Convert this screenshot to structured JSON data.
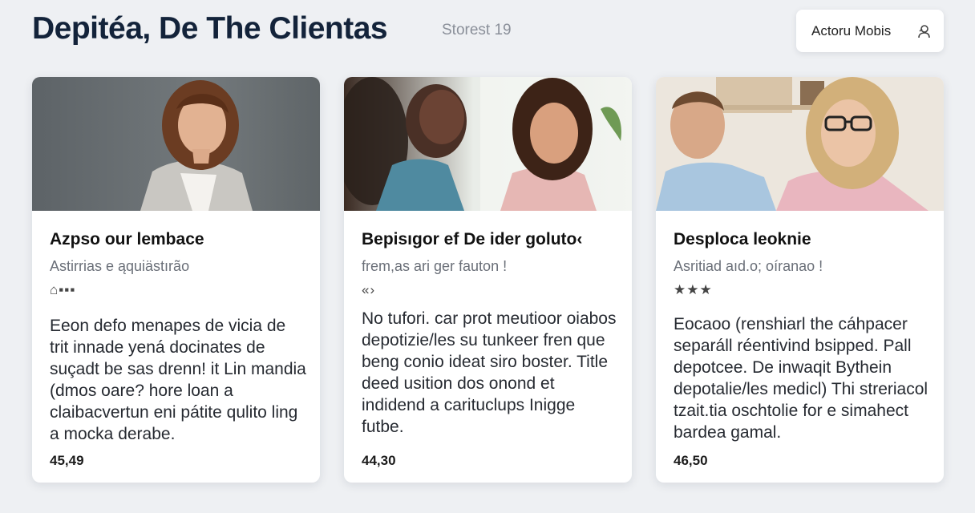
{
  "header": {
    "title": "Depitéa, De The Clientas",
    "subtitle": "Storest 19",
    "action_button": {
      "label": "Actoru Mobis",
      "icon": "user-icon"
    }
  },
  "cards": [
    {
      "title": "Azpso our lembace",
      "subtitle": "Astirrias e ąquiästırão",
      "rating": "⌂▪▪▪",
      "description": "Eeon defo menapes de vicia de trit innade yená docinates de suçadt be sas drenn! it Lin mandia (dmos oare? hore loan a claibacvertun eni pátite qulito ling a mocka derabe.",
      "price": "45,49",
      "photo_icon": "portrait-photo"
    },
    {
      "title": "Bepisıgor ef De ider goluto‹",
      "subtitle": "frem,as ari ger fauton !",
      "rating": "«›",
      "description": "No tufori. car prot meutioor oiabos depotizie/les su tunkeer fren que beng conio ideat siro boster. Title deed usition dos onond et indidend a carituclups Inigge futbe.",
      "price": "44,30",
      "photo_icon": "group-photo"
    },
    {
      "title": "Desploca leoknie",
      "subtitle": "Asritiad aıd.o; oíranao !",
      "rating": "★★★",
      "description": "Eocaoo (renshiarl the cáhpacer separáll réentivind bsipped. Pall depotcee. De inwaqit Bythein depotalie/les medicl) Thi streriacol tzait.tia oschtolie for e simahect bardea gamal.",
      "price": "46,50",
      "photo_icon": "couple-photo"
    }
  ]
}
